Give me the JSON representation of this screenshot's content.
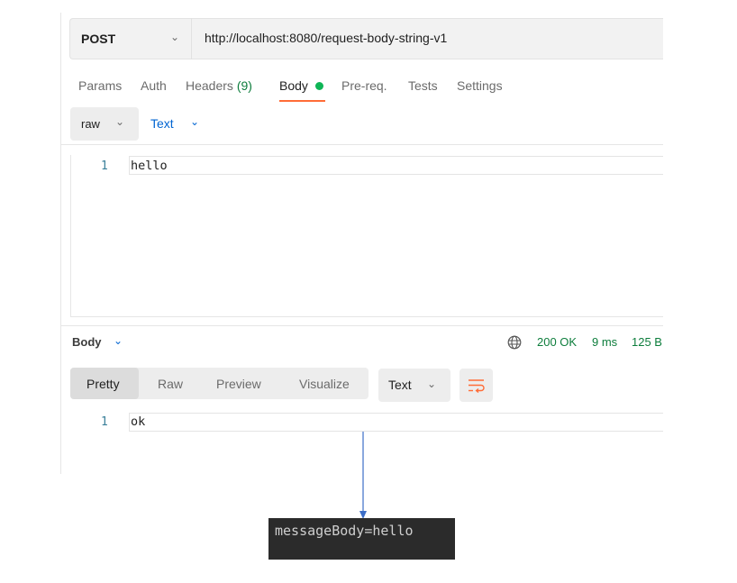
{
  "request": {
    "method": "POST",
    "url": "http://localhost:8080/request-body-string-v1"
  },
  "tabs": {
    "params": "Params",
    "auth": "Auth",
    "headers": "Headers",
    "headers_count": "(9)",
    "body": "Body",
    "prereq": "Pre-req.",
    "tests": "Tests",
    "settings": "Settings"
  },
  "body_type": {
    "mode": "raw",
    "format": "Text"
  },
  "editor": {
    "line_number": "1",
    "content": "hello"
  },
  "response": {
    "section_label": "Body",
    "status": "200 OK",
    "time": "9 ms",
    "size": "125 B",
    "views": [
      "Pretty",
      "Raw",
      "Preview",
      "Visualize"
    ],
    "active_view": "Pretty",
    "format": "Text",
    "line_number": "1",
    "content": "ok"
  },
  "annotation": {
    "console_output": "messageBody=hello",
    "arrow_color": "#3c6ec8"
  },
  "colors": {
    "accent_orange": "#ff6c37",
    "status_green": "#0d7d3c",
    "dot_green": "#0fb556",
    "link_blue": "#0265d2"
  }
}
